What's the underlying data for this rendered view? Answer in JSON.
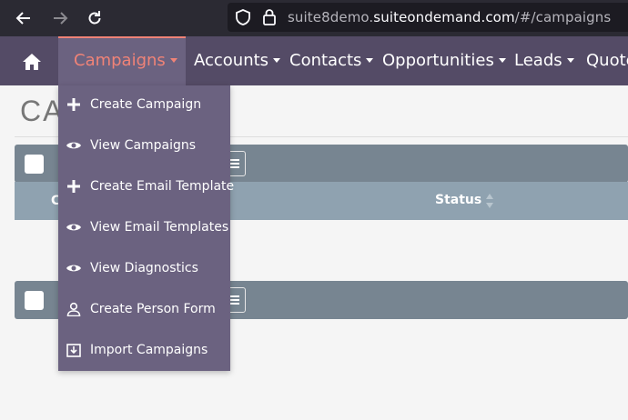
{
  "browser": {
    "url_prefix": "suite8demo.",
    "url_host": "suiteondemand.com",
    "url_path": "/#/campaigns"
  },
  "navbar": {
    "home_icon": "home-icon",
    "items": [
      {
        "label": "Campaigns",
        "active": true
      },
      {
        "label": "Accounts"
      },
      {
        "label": "Contacts"
      },
      {
        "label": "Opportunities"
      },
      {
        "label": "Leads"
      },
      {
        "label": "Quote"
      }
    ],
    "colors": {
      "bar": "#544b66",
      "active_bg": "#6b6280",
      "active_text": "#f08377"
    }
  },
  "page": {
    "title": "CA"
  },
  "table": {
    "header_col_partial": "C",
    "status_header": "Status"
  },
  "dropdown": {
    "items": [
      {
        "label": "Create Campaign",
        "icon": "plus-icon"
      },
      {
        "label": "View Campaigns",
        "icon": "eye-icon"
      },
      {
        "label": "Create Email Template",
        "icon": "plus-icon"
      },
      {
        "label": "View Email Templates",
        "icon": "eye-icon"
      },
      {
        "label": "View Diagnostics",
        "icon": "eye-icon"
      },
      {
        "label": "Create Person Form",
        "icon": "person-icon"
      },
      {
        "label": "Import Campaigns",
        "icon": "import-icon"
      }
    ]
  }
}
